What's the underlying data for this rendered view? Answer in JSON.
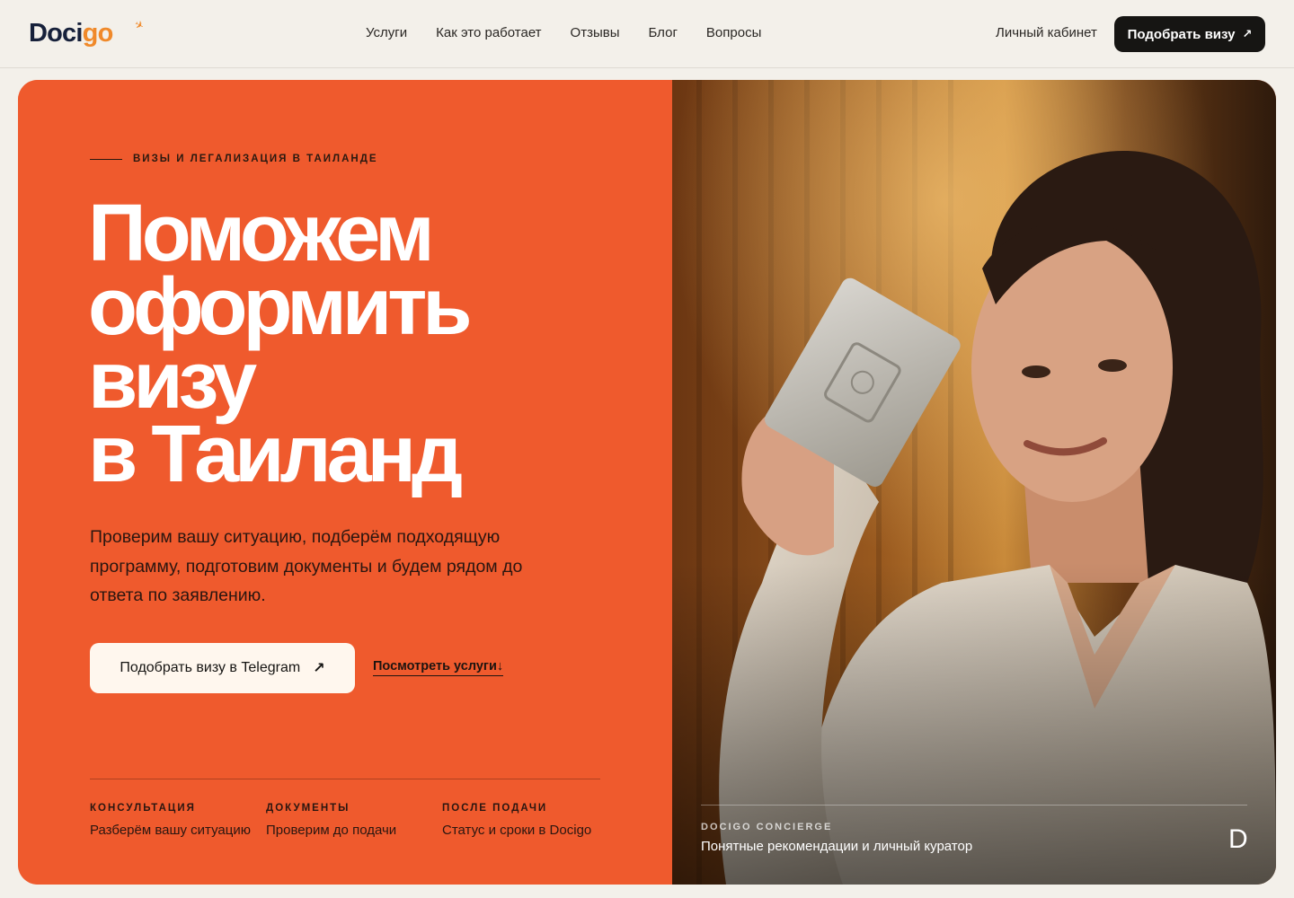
{
  "header": {
    "logo_part1": "Doci",
    "logo_part2": "go",
    "nav": [
      "Услуги",
      "Как это работает",
      "Отзывы",
      "Блог",
      "Вопросы"
    ],
    "cabinet": "Личный кабинет",
    "cta": "Подобрать визу",
    "cta_icon": "arrow-up-right-icon"
  },
  "hero": {
    "eyebrow": "ВИЗЫ И ЛЕГАЛИЗАЦИЯ В ТАИЛАНДЕ",
    "title_lines": [
      "Поможем",
      "оформить",
      "визу",
      "в Таиланд"
    ],
    "lead": "Проверим вашу ситуацию, подберём подходящую программу, подготовим документы и будем рядом до ответа по заявлению.",
    "primary_button": "Подобрать визу в Telegram",
    "primary_icon": "arrow-up-right-icon",
    "secondary_link": "Посмотреть услуги↓",
    "features": [
      {
        "key": "КОНСУЛЬТАЦИЯ",
        "value": "Разберём вашу ситуацию"
      },
      {
        "key": "ДОКУМЕНТЫ",
        "value": "Проверим до подачи"
      },
      {
        "key": "ПОСЛЕ ПОДАЧИ",
        "value": "Статус и сроки в Docigo"
      }
    ],
    "photo_caption_key": "DOCIGO CONCIERGE",
    "photo_caption_value": "Понятные рекомендации и личный куратор",
    "photo_badge": "D",
    "colors": {
      "accent": "#ef5a2d",
      "dark": "#161513",
      "background": "#f3f0ea",
      "logo_orange": "#f0892a",
      "logo_navy": "#16203a"
    }
  }
}
